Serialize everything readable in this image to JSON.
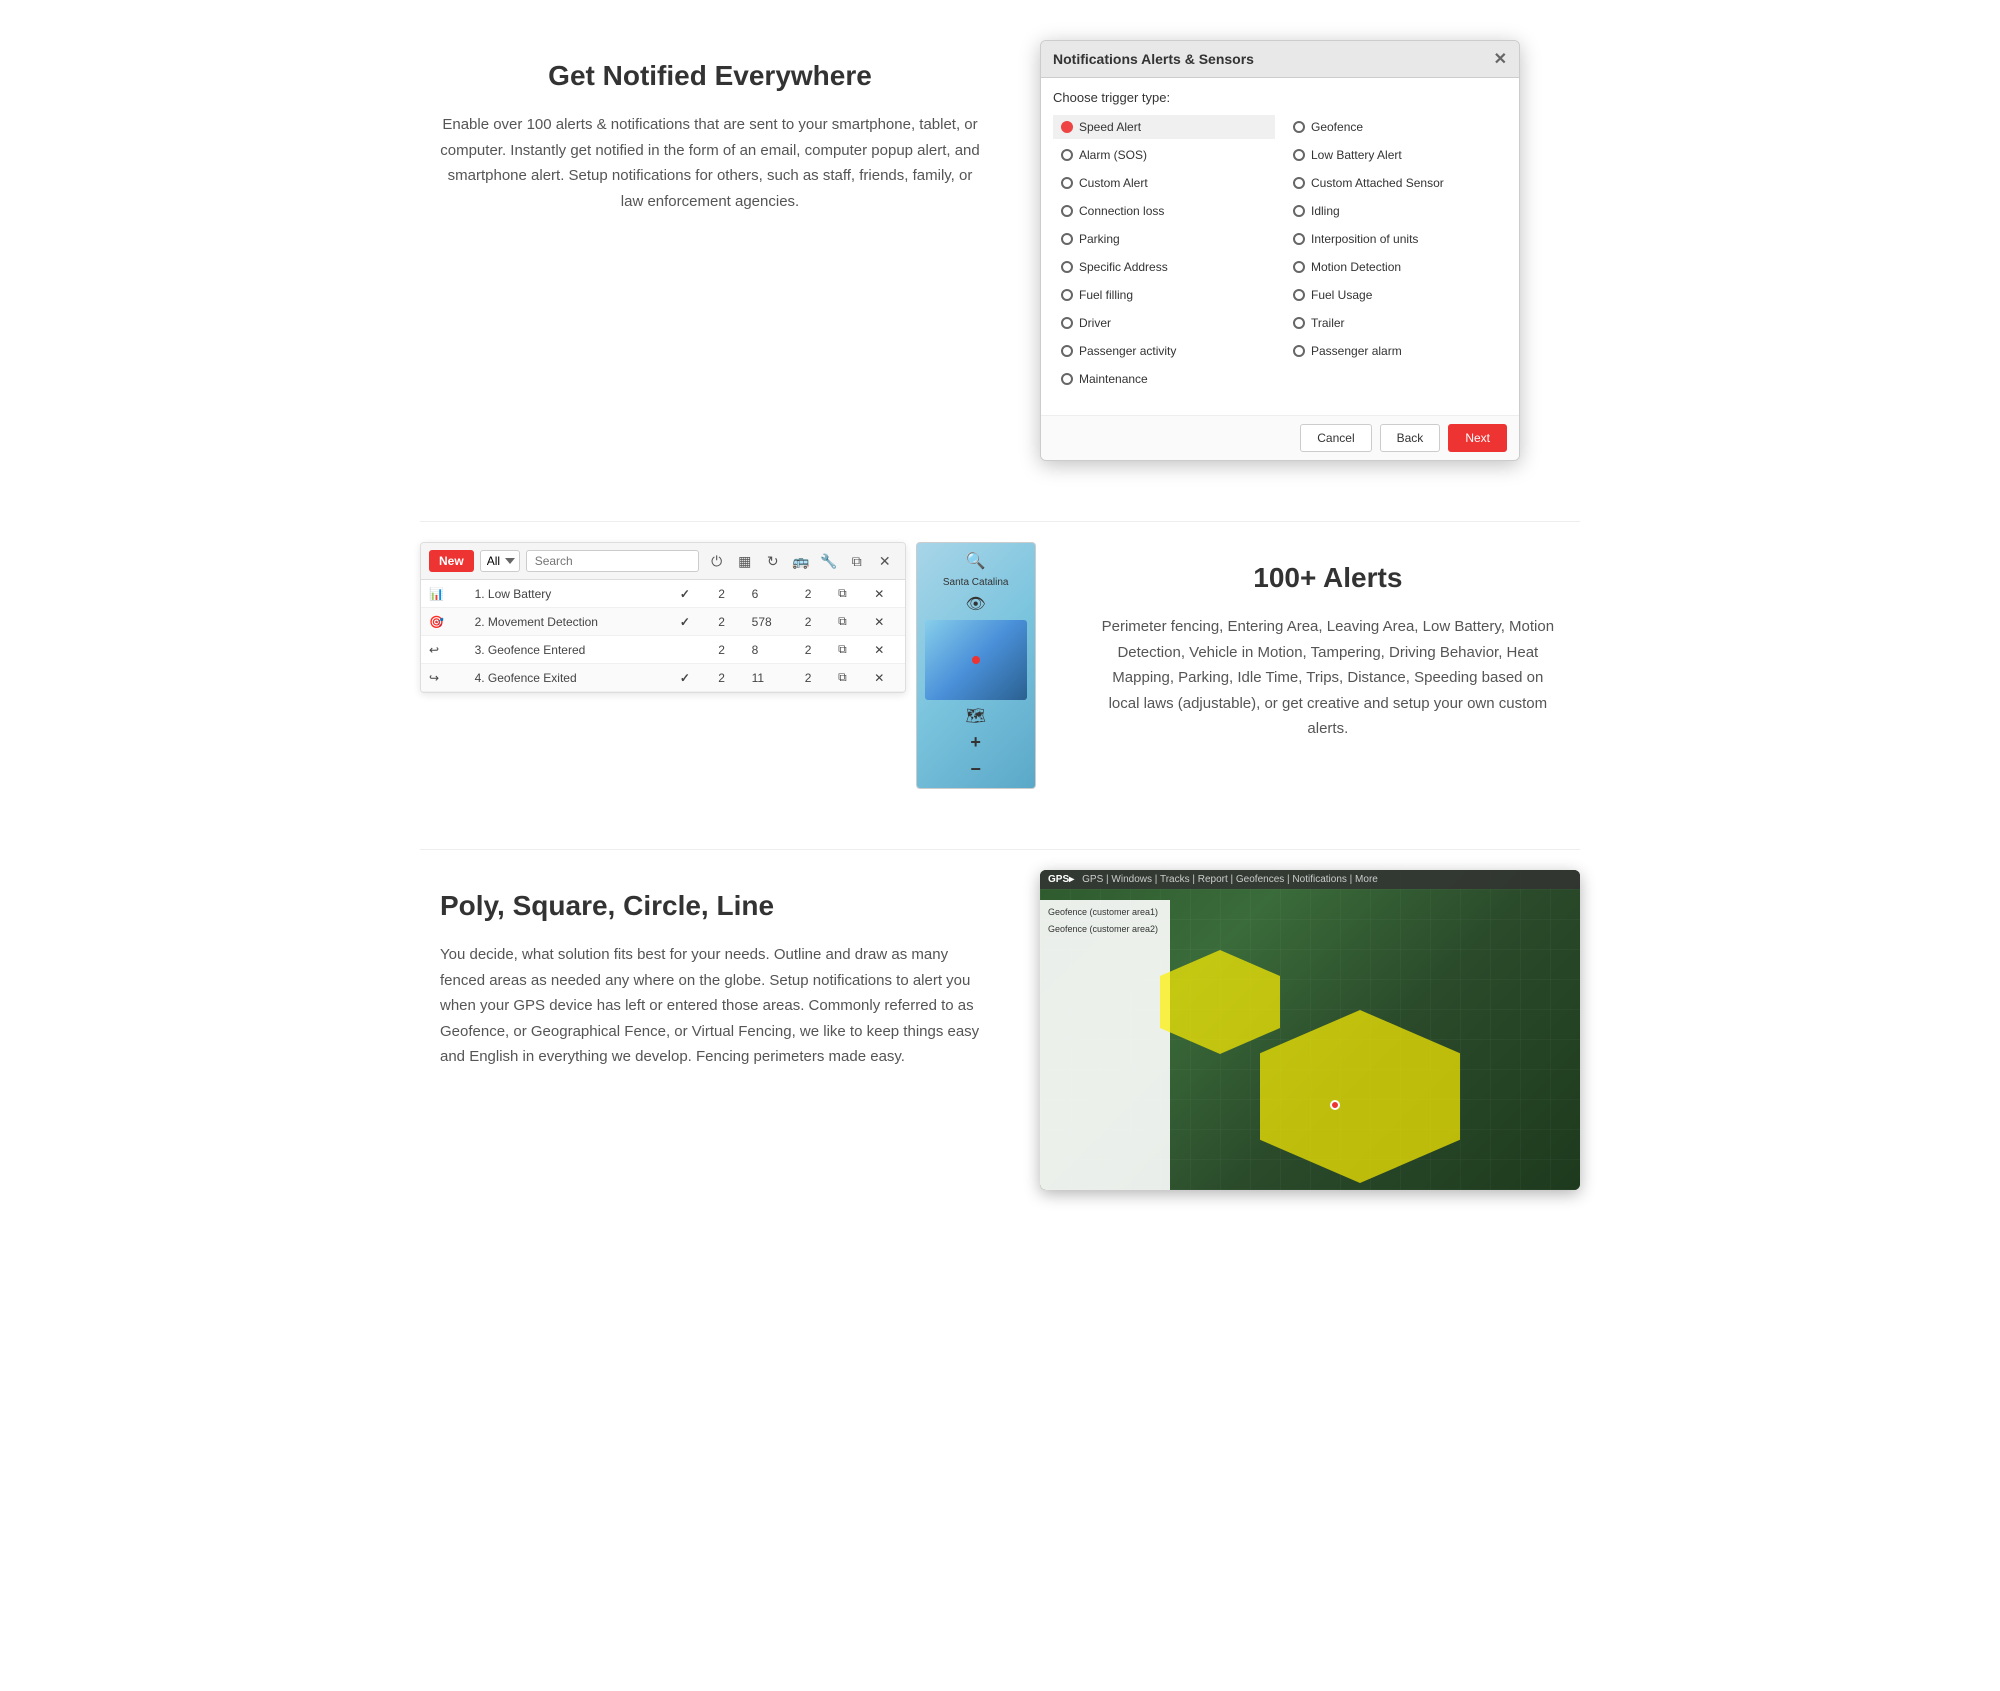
{
  "section1": {
    "title": "Get Notified Everywhere",
    "description": "Enable over 100 alerts & notifications that are sent to your smartphone, tablet, or computer. Instantly get notified in the form of an email, computer popup alert, and smartphone alert. Setup notifications for others, such as staff, friends, family, or law enforcement agencies."
  },
  "modal": {
    "title": "Notifications Alerts & Sensors",
    "trigger_label": "Choose trigger type:",
    "options": [
      {
        "label": "Speed Alert",
        "selected": true
      },
      {
        "label": "Geofence",
        "selected": false
      },
      {
        "label": "Alarm (SOS)",
        "selected": false
      },
      {
        "label": "Low Battery Alert",
        "selected": false
      },
      {
        "label": "Custom Alert",
        "selected": false
      },
      {
        "label": "Custom Attached Sensor",
        "selected": false
      },
      {
        "label": "Connection loss",
        "selected": false
      },
      {
        "label": "Idling",
        "selected": false
      },
      {
        "label": "Parking",
        "selected": false
      },
      {
        "label": "Interposition of units",
        "selected": false
      },
      {
        "label": "Specific Address",
        "selected": false
      },
      {
        "label": "Motion Detection",
        "selected": false
      },
      {
        "label": "Fuel filling",
        "selected": false
      },
      {
        "label": "Fuel Usage",
        "selected": false
      },
      {
        "label": "Driver",
        "selected": false
      },
      {
        "label": "Trailer",
        "selected": false
      },
      {
        "label": "Passenger activity",
        "selected": false
      },
      {
        "label": "Passenger alarm",
        "selected": false
      },
      {
        "label": "Maintenance",
        "selected": false
      }
    ],
    "cancel_btn": "Cancel",
    "back_btn": "Back",
    "next_btn": "Next"
  },
  "alerts_table": {
    "new_btn": "New",
    "select_placeholder": "All",
    "search_placeholder": "Search",
    "rows": [
      {
        "icon": "bar-chart",
        "name": "1. Low Battery",
        "check": true,
        "col3": "2",
        "col4": "6",
        "col5": "2"
      },
      {
        "icon": "circle-dot",
        "name": "2. Movement Detection",
        "check": true,
        "col3": "2",
        "col4": "578",
        "col5": "2"
      },
      {
        "icon": "arrow-in",
        "name": "3. Geofence Entered",
        "check": false,
        "col3": "2",
        "col4": "8",
        "col5": "2"
      },
      {
        "icon": "arrow-out",
        "name": "4. Geofence Exited",
        "check": true,
        "col3": "2",
        "col4": "11",
        "col5": "2"
      }
    ]
  },
  "section2": {
    "title": "100+ Alerts",
    "description": "Perimeter fencing, Entering Area, Leaving Area, Low Battery, Motion Detection, Vehicle in Motion, Tampering, Driving Behavior, Heat Mapping, Parking, Idle Time, Trips, Distance, Speeding based on local laws (adjustable), or get creative and setup your own custom alerts."
  },
  "section3": {
    "title": "Poly, Square, Circle, Line",
    "description": "You decide, what solution fits best for your needs. Outline and draw as many fenced areas as needed any where on the globe. Setup notifications to alert you when your GPS device has left or entered those areas. Commonly referred to as Geofence, or Geographical Fence, or Virtual Fencing, we like to keep things easy and English in everything we develop. Fencing perimeters made easy."
  },
  "map_label": "Santa Catalina",
  "geo_toolbar": "GPS | Windows | Tracks | Report | Geofences | Notifications | More"
}
